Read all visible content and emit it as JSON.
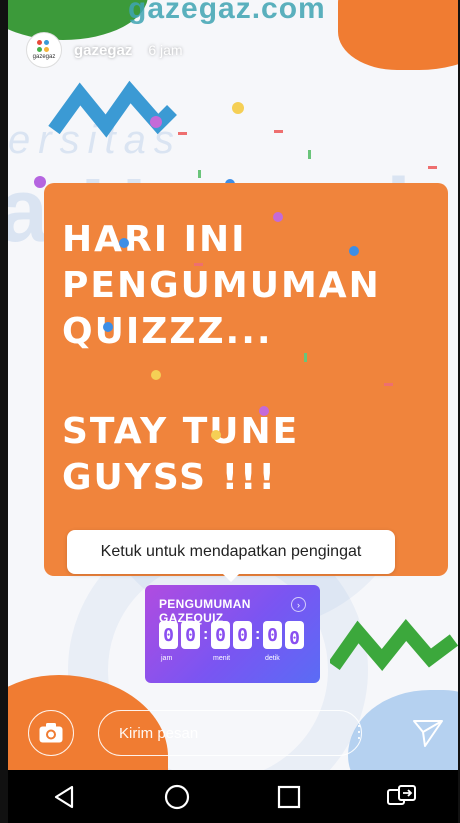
{
  "watermark": {
    "site": "gazegaz.com",
    "sub": "ersitas",
    "brand": "a Unggul"
  },
  "header": {
    "logo_text": "gazegaz",
    "username": "gazegaz",
    "time": "6 jam"
  },
  "card": {
    "line_block_1": "HARI INI\nPENGUMUMAN\nQUIZZZ...",
    "line_block_2": "STAY TUNE\nGUYSS !!!"
  },
  "reminder": {
    "label": "Ketuk untuk mendapatkan pengingat"
  },
  "countdown": {
    "title": "PENGUMUMAN GAZEQUIZ",
    "digits": [
      "0",
      "0",
      "0",
      "0",
      "0",
      "0"
    ],
    "labels": {
      "hours": "jam",
      "minutes": "menit",
      "seconds": "detik"
    }
  },
  "message_bar": {
    "placeholder": "Kirim pesan"
  },
  "icons": {
    "camera": "camera-icon",
    "send": "send-icon",
    "more": "more-vertical-icon",
    "back": "back-icon",
    "home": "home-icon",
    "recents": "recents-icon",
    "switch": "switch-app-icon"
  },
  "colors": {
    "card": "#f0843c",
    "countdown_start": "#b04ce0",
    "countdown_end": "#5a6cf5",
    "zigzag_blue": "#3b9ad4",
    "zigzag_green": "#3ca83c"
  }
}
